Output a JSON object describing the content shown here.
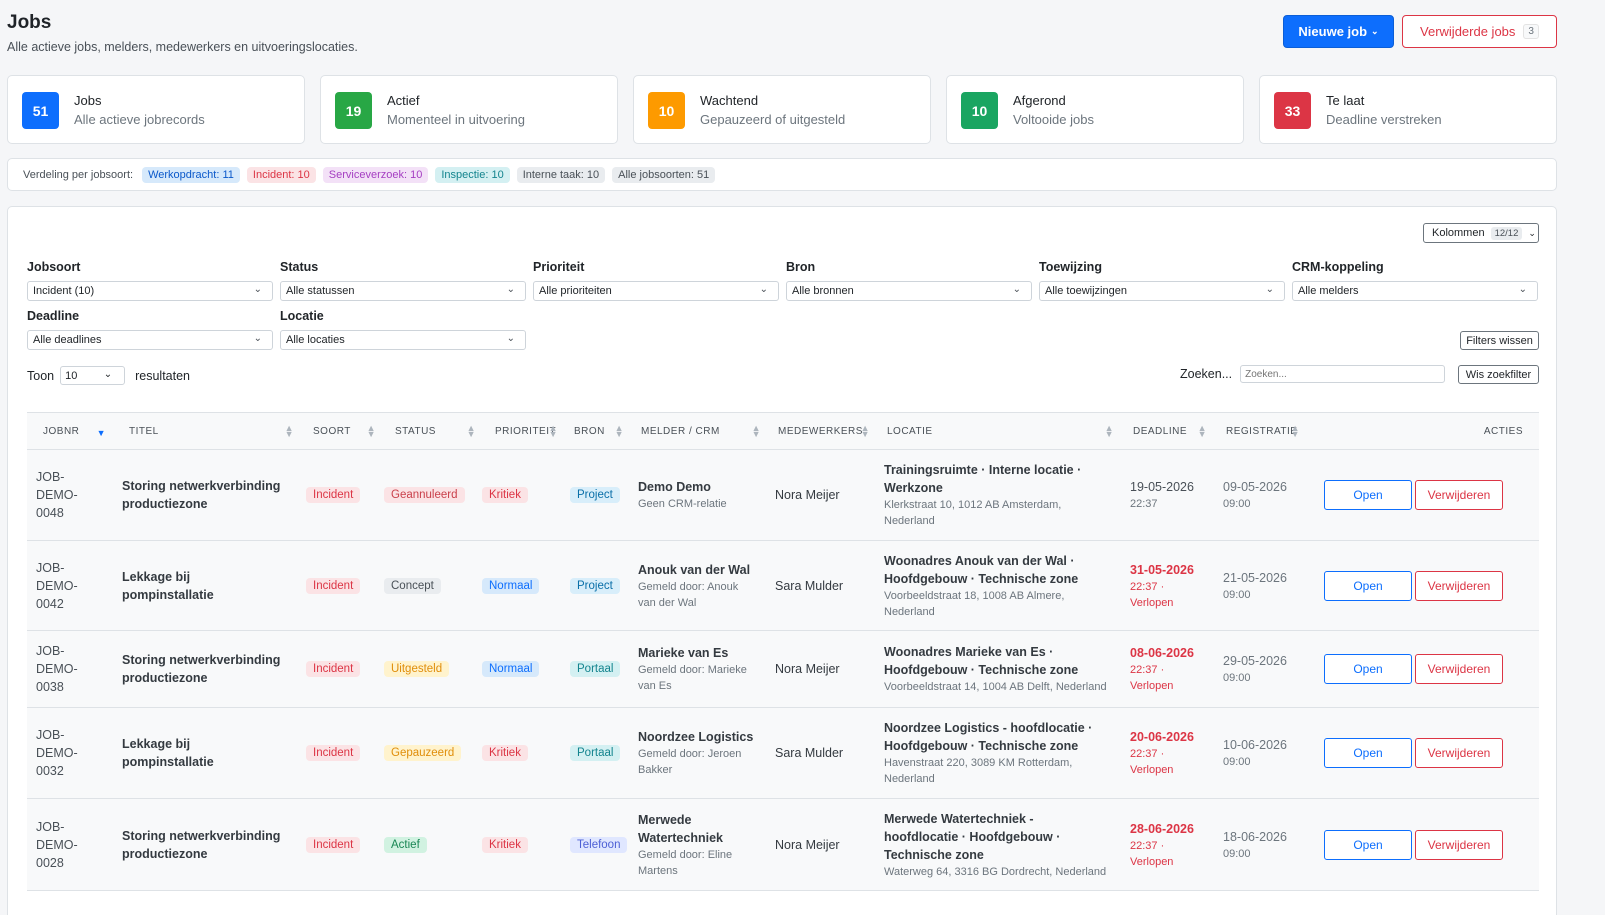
{
  "header": {
    "title": "Jobs",
    "subtitle": "Alle actieve jobs, melders, medewerkers en uitvoeringslocaties.",
    "new_job_label": "Nieuwe job",
    "deleted_jobs_label": "Verwijderde jobs",
    "deleted_jobs_count": "3"
  },
  "stats": [
    {
      "num": "51",
      "label": "Jobs",
      "desc": "Alle actieve jobrecords",
      "color": "#0d6efd"
    },
    {
      "num": "19",
      "label": "Actief",
      "desc": "Momenteel in uitvoering",
      "color": "#28a745"
    },
    {
      "num": "10",
      "label": "Wachtend",
      "desc": "Gepauzeerd of uitgesteld",
      "color": "#fd9a00"
    },
    {
      "num": "10",
      "label": "Afgerond",
      "desc": "Voltooide jobs",
      "color": "#1aa561"
    },
    {
      "num": "33",
      "label": "Te laat",
      "desc": "Deadline verstreken",
      "color": "#dc3545"
    }
  ],
  "distribution": {
    "label": "Verdeling per jobsoort:",
    "chips": [
      {
        "text": "Werkopdracht: 11",
        "bg": "#d6e9fb",
        "fg": "#0a58ca"
      },
      {
        "text": "Incident: 10",
        "bg": "#fbe3e5",
        "fg": "#dc3545"
      },
      {
        "text": "Serviceverzoek: 10",
        "bg": "#f3e1f7",
        "fg": "#a53ec2"
      },
      {
        "text": "Inspectie: 10",
        "bg": "#d4f0f2",
        "fg": "#13848e"
      },
      {
        "text": "Interne taak: 10",
        "bg": "#e9ecef",
        "fg": "#495057"
      },
      {
        "text": "Alle jobsoorten: 51",
        "bg": "#e9ecef",
        "fg": "#495057"
      }
    ]
  },
  "columns_button": {
    "label": "Kolommen",
    "count": "12/12"
  },
  "filters": {
    "jobsoort": {
      "label": "Jobsoort",
      "value": "Incident (10)"
    },
    "status": {
      "label": "Status",
      "value": "Alle statussen"
    },
    "prioriteit": {
      "label": "Prioriteit",
      "value": "Alle prioriteiten"
    },
    "bron": {
      "label": "Bron",
      "value": "Alle bronnen"
    },
    "toewijzing": {
      "label": "Toewijzing",
      "value": "Alle toewijzingen"
    },
    "crm": {
      "label": "CRM-koppeling",
      "value": "Alle melders"
    },
    "deadline": {
      "label": "Deadline",
      "value": "Alle deadlines"
    },
    "locatie": {
      "label": "Locatie",
      "value": "Alle locaties"
    },
    "clear_label": "Filters wissen"
  },
  "table_controls": {
    "show_label": "Toon",
    "page_size": "10",
    "results_label": "resultaten",
    "search_label": "Zoeken...",
    "search_placeholder": "Zoeken...",
    "clear_search_label": "Wis zoekfilter"
  },
  "table": {
    "headers": [
      "JOBNR",
      "TITEL",
      "SOORT",
      "STATUS",
      "PRIORITEIT",
      "BRON",
      "MELDER / CRM",
      "MEDEWERKERS",
      "LOCATIE",
      "DEADLINE",
      "REGISTRATIE",
      "ACTIES"
    ],
    "rows": [
      {
        "jobnr": [
          "JOB-",
          "DEMO-",
          "0048"
        ],
        "titel": "Storing netwerkverbinding productiezone",
        "soort": "Incident",
        "status": "Geannuleerd",
        "prioriteit": "Kritiek",
        "bron": "Project",
        "melder": "Demo Demo",
        "melder_sub": "Geen CRM-relatie",
        "medewerkers": "Nora Meijer",
        "locatie": "Trainingsruimte · Interne locatie · Werkzone",
        "locatie_sub": "Klerkstraat 10, 1012 AB Amsterdam, Nederland",
        "deadline": "19-05-2026",
        "deadline_time": "22:37",
        "registratie": "09-05-2026",
        "registratie_time": "09:00",
        "open": "Open",
        "delete": "Verwijderen"
      },
      {
        "jobnr": [
          "JOB-",
          "DEMO-",
          "0042"
        ],
        "titel": "Lekkage bij pompinstallatie",
        "soort": "Incident",
        "status": "Concept",
        "prioriteit": "Normaal",
        "bron": "Project",
        "melder": "Anouk van der Wal",
        "melder_sub": "Gemeld door: Anouk van der Wal",
        "medewerkers": "Sara Mulder",
        "locatie": "Woonadres Anouk van der Wal · Hoofdgebouw · Technische zone",
        "locatie_sub": "Voorbeeldstraat 18, 1008 AB Almere, Nederland",
        "deadline": "31-05-2026",
        "deadline_time": "22:37 · Verlopen",
        "registratie": "21-05-2026",
        "registratie_time": "09:00",
        "open": "Open",
        "delete": "Verwijderen"
      },
      {
        "jobnr": [
          "JOB-",
          "DEMO-",
          "0038"
        ],
        "titel": "Storing netwerkverbinding productiezone",
        "soort": "Incident",
        "status": "Uitgesteld",
        "prioriteit": "Normaal",
        "bron": "Portaal",
        "melder": "Marieke van Es",
        "melder_sub": "Gemeld door: Marieke van Es",
        "medewerkers": "Nora Meijer",
        "locatie": "Woonadres Marieke van Es · Hoofdgebouw · Technische zone",
        "locatie_sub": "Voorbeeldstraat 14, 1004 AB Delft, Nederland",
        "deadline": "08-06-2026",
        "deadline_time": "22:37 · Verlopen",
        "registratie": "29-05-2026",
        "registratie_time": "09:00",
        "open": "Open",
        "delete": "Verwijderen"
      },
      {
        "jobnr": [
          "JOB-",
          "DEMO-",
          "0032"
        ],
        "titel": "Lekkage bij pompinstallatie",
        "soort": "Incident",
        "status": "Gepauzeerd",
        "prioriteit": "Kritiek",
        "bron": "Portaal",
        "melder": "Noordzee Logistics",
        "melder_sub": "Gemeld door: Jeroen Bakker",
        "medewerkers": "Sara Mulder",
        "locatie": "Noordzee Logistics - hoofdlocatie · Hoofdgebouw · Technische zone",
        "locatie_sub": "Havenstraat 220, 3089 KM Rotterdam, Nederland",
        "deadline": "20-06-2026",
        "deadline_time": "22:37 · Verlopen",
        "registratie": "10-06-2026",
        "registratie_time": "09:00",
        "open": "Open",
        "delete": "Verwijderen"
      },
      {
        "jobnr": [
          "JOB-",
          "DEMO-",
          "0028"
        ],
        "titel": "Storing netwerkverbinding productiezone",
        "soort": "Incident",
        "status": "Actief",
        "prioriteit": "Kritiek",
        "bron": "Telefoon",
        "melder": "Merwede Watertechniek",
        "melder_sub": "Gemeld door: Eline Martens",
        "medewerkers": "Nora Meijer",
        "locatie": "Merwede Watertechniek - hoofdlocatie · Hoofdgebouw · Technische zone",
        "locatie_sub": "Waterweg 64, 3316 BG Dordrecht, Nederland",
        "deadline": "28-06-2026",
        "deadline_time": "22:37 · Verlopen",
        "registratie": "18-06-2026",
        "registratie_time": "09:00",
        "open": "Open",
        "delete": "Verwijderen"
      }
    ]
  }
}
